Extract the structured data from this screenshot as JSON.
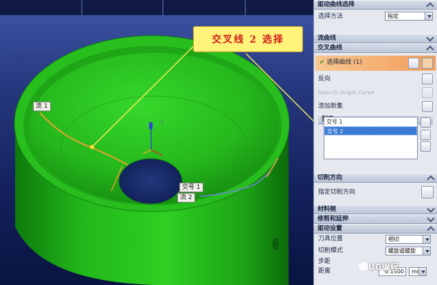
{
  "viewport": {
    "callout": "交叉线 2 选择",
    "tags": {
      "flow1": "流 1",
      "flow2": "流 2",
      "cross1": "交号 1"
    }
  },
  "panel": {
    "drive_curve_select": {
      "title": "驱动曲线选择"
    },
    "select_method": {
      "label": "选择方法",
      "value": "指定"
    },
    "flow_curve": {
      "title": "流曲线"
    },
    "cross_curve": {
      "title": "交叉曲线",
      "select_curve": "选择曲线 (1)",
      "reverse": "反向",
      "specify_origin": "Specify Origin Curve",
      "add_new_set": "添加新集"
    },
    "list": {
      "title": "列表",
      "items": [
        "交号 1",
        "交号 2"
      ]
    },
    "cut_direction": {
      "title": "切削方向",
      "label": "指定切削方向"
    },
    "material_side": {
      "title": "材料侧"
    },
    "trim_extend": {
      "title": "修剪和延伸"
    },
    "drive_settings": {
      "title": "驱动设置",
      "tool_position": {
        "label": "刀具位置",
        "value": "相切"
      },
      "cut_mode": {
        "label": "切削模式",
        "value": "螺旋或螺旋"
      },
      "step": {
        "label": "步距",
        "value": ""
      },
      "distance": {
        "label": "距离",
        "value": "0.1500",
        "unit": "mm"
      }
    }
  },
  "watermark": "UG编程",
  "colors": {
    "accent_orange": "#f3a96a",
    "callout_bg": "#fff37a",
    "model_green": "#22c21a"
  }
}
